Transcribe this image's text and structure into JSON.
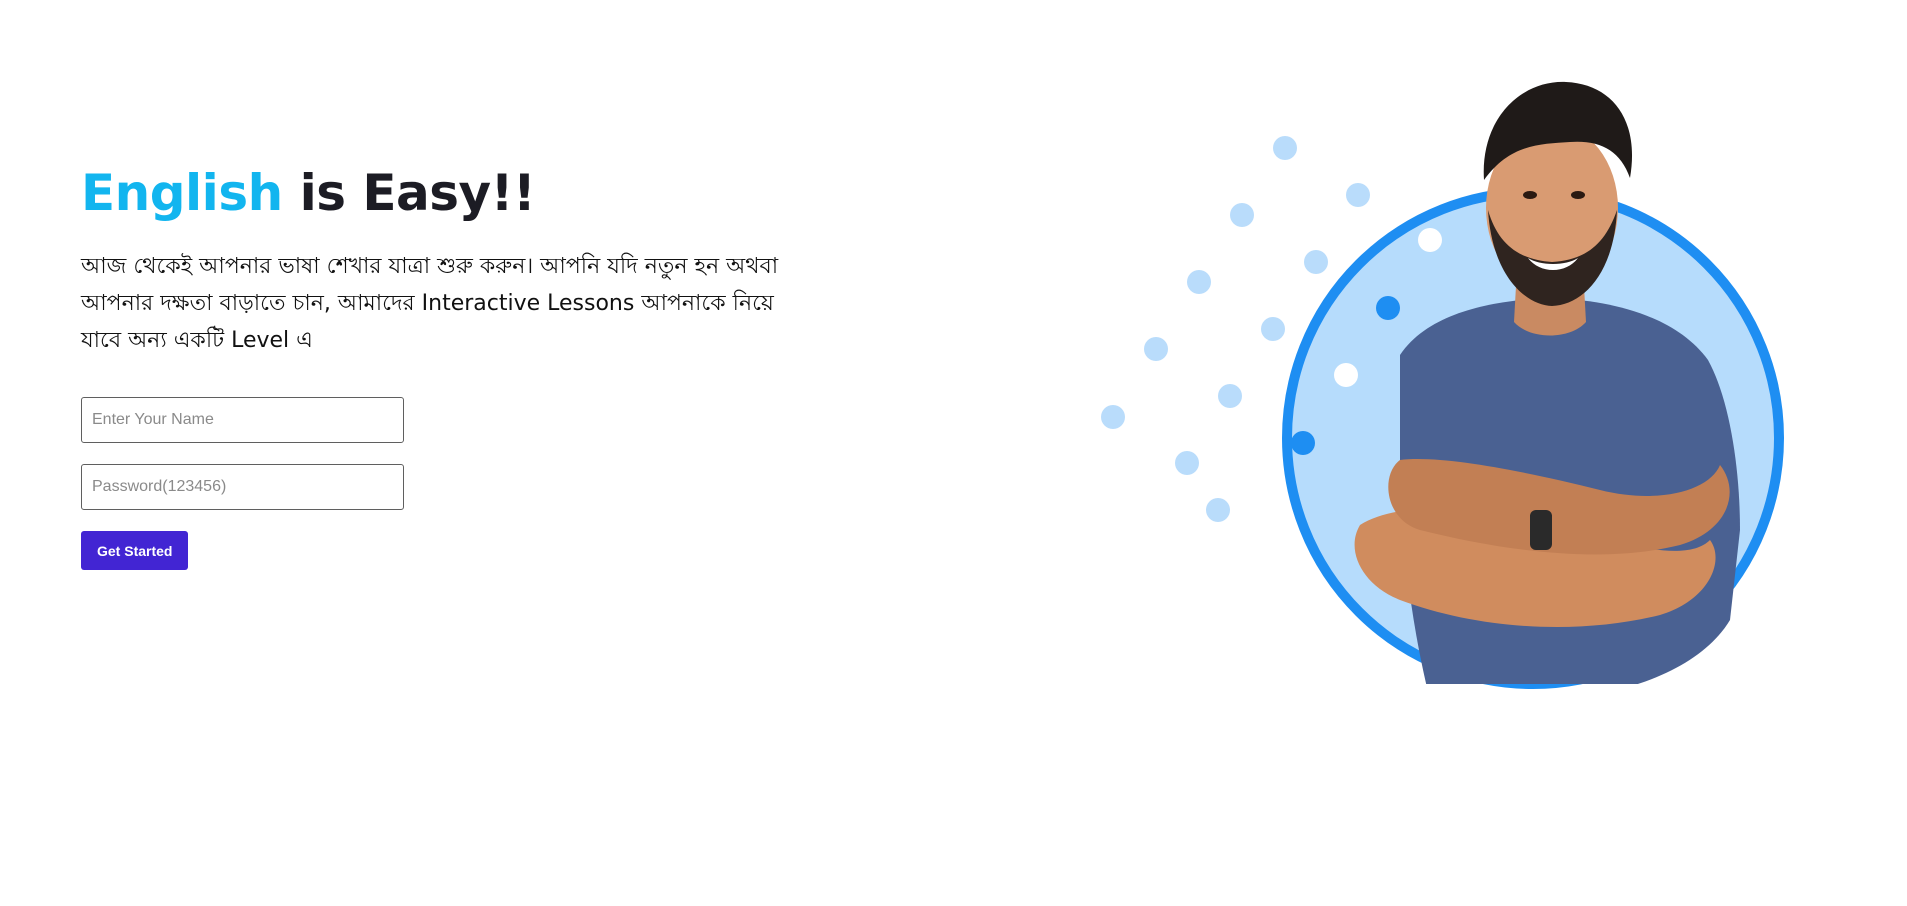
{
  "hero": {
    "headline_accent": "English",
    "headline_rest": " is Easy!!",
    "subtitle": "আজ থেকেই আপনার ভাষা শেখার যাত্রা শুরু করুন। আপনি যদি নতুন হন অথবা আপনার দক্ষতা বাড়াতে চান, আমাদের Interactive Lessons আপনাকে নিয়ে যাবে অন্য একটি Level এ"
  },
  "form": {
    "name_placeholder": "Enter Your Name",
    "password_placeholder": "Password(123456)",
    "submit_label": "Get Started"
  },
  "colors": {
    "accent": "#12b5ef",
    "button": "#4225d3",
    "ring": "#1e8ef2",
    "circle_fill": "#b6dcfc",
    "dot_light": "#b9dcfb",
    "dot_dark": "#1e8ef2"
  },
  "illustration": {
    "icon": "person-portrait-icon"
  }
}
